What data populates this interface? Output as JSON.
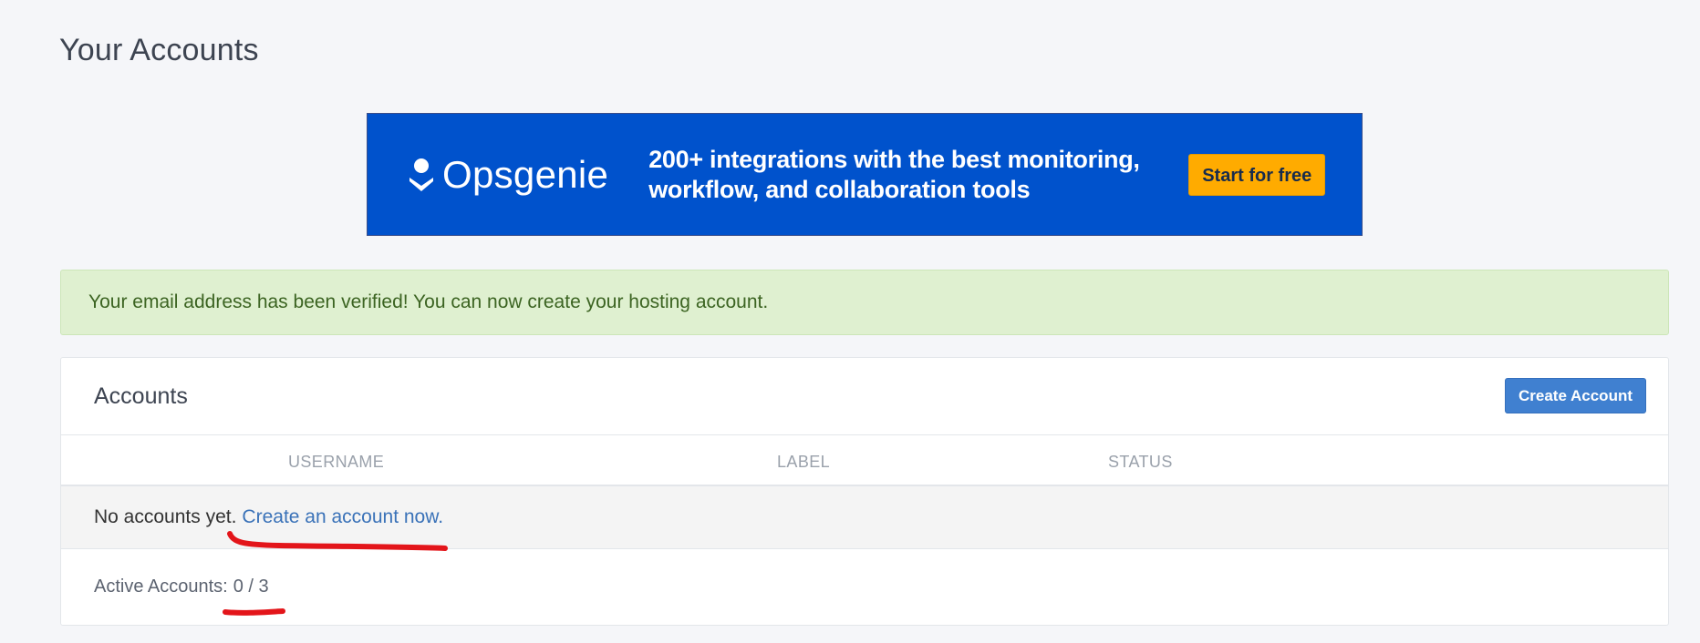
{
  "page": {
    "title": "Your Accounts"
  },
  "ad": {
    "brand": "Opsgenie",
    "headline_line1": "200+ integrations with the best monitoring,",
    "headline_line2": "workflow, and collaboration tools",
    "cta_label": "Start for free",
    "background_color": "#0052cc",
    "cta_color": "#ffab00"
  },
  "alert": {
    "message": "Your email address has been verified! You can now create your hosting account.",
    "color": "#dff0d0"
  },
  "accounts": {
    "panel_title": "Accounts",
    "create_button_label": "Create Account",
    "columns": [
      "USERNAME",
      "LABEL",
      "STATUS"
    ],
    "empty_text": "No accounts yet.",
    "empty_link": "Create an account now.",
    "active_label": "Active Accounts:",
    "active_value": "0 / 3",
    "accent_color": "#4080d0"
  },
  "annotations": {
    "underline_color": "#e3151a"
  }
}
